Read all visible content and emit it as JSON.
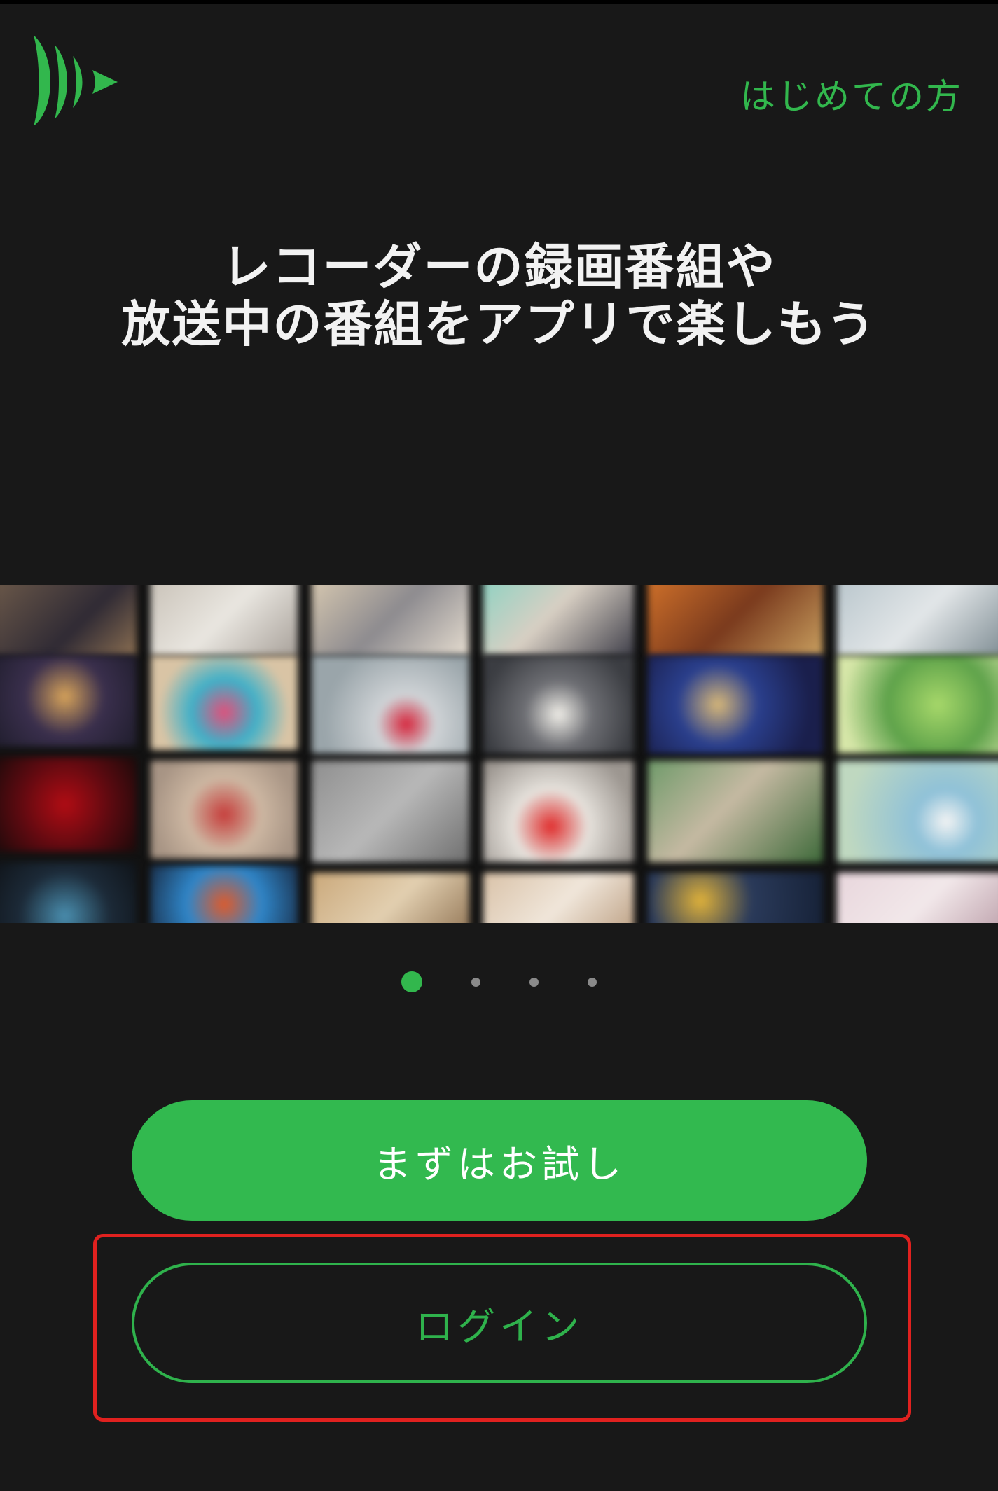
{
  "header": {
    "logo_icon": "app-logo-icon",
    "first_time_link": "はじめての方"
  },
  "hero": {
    "headline_line1": "レコーダーの録画番組や",
    "headline_line2": "放送中の番組をアプリで楽しもう"
  },
  "carousel": {
    "page_count": 4,
    "active_index": 0
  },
  "actions": {
    "try_label": "まずはお試し",
    "login_label": "ログイン"
  },
  "colors": {
    "accent": "#32b74d",
    "background": "#181818",
    "highlight": "#e0211f"
  }
}
